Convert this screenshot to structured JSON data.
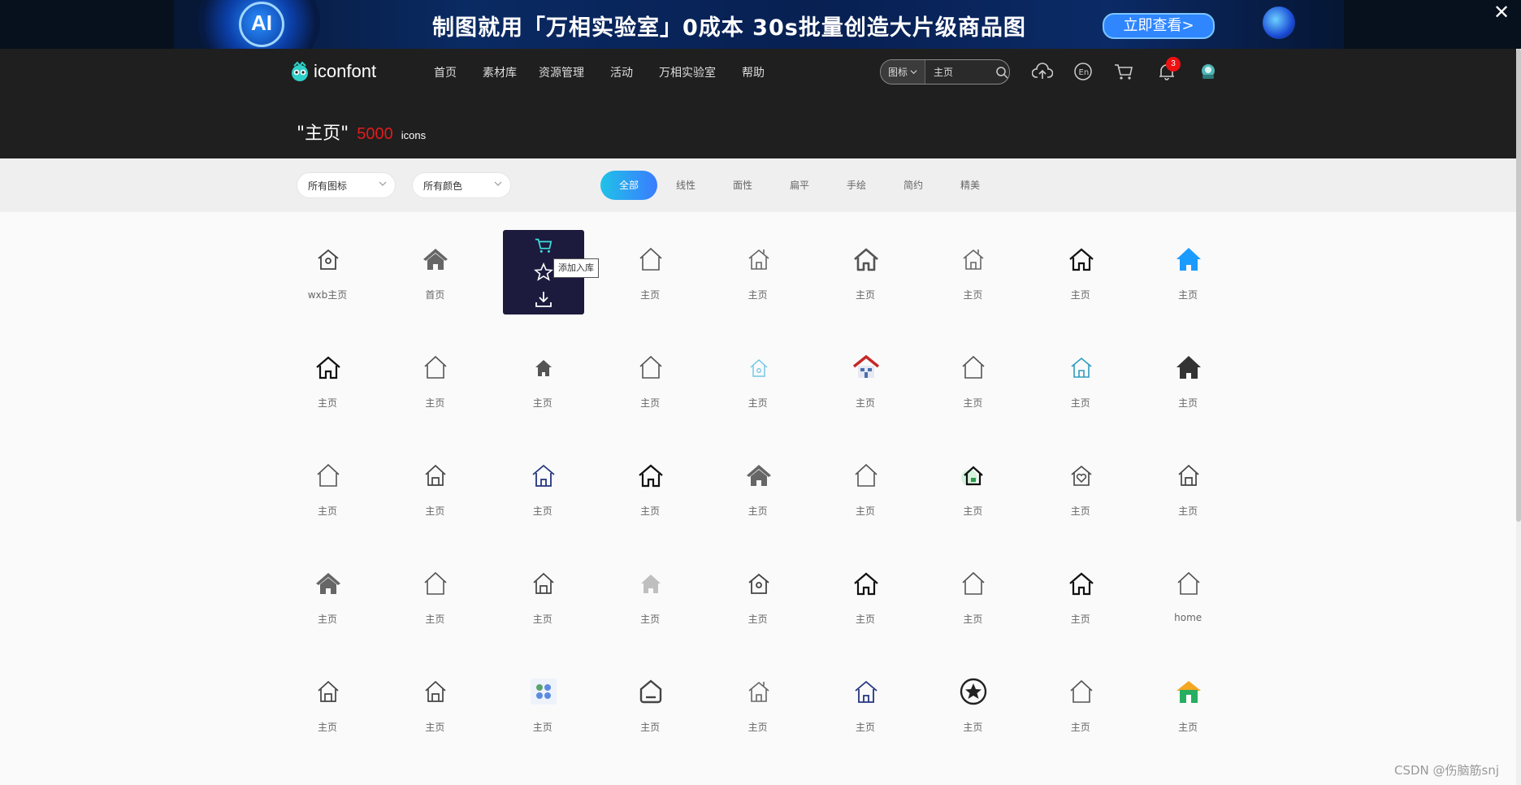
{
  "banner": {
    "orb_text": "AI",
    "headline": "制图就用「万相实验室」0成本 30s批量创造大片级商品图",
    "cta": "立即查看>"
  },
  "header": {
    "logo_text": "iconfont",
    "nav": [
      "首页",
      "素材库",
      "资源管理",
      "活动",
      "万相实验室",
      "帮助"
    ],
    "search": {
      "type": "图标",
      "value": "主页"
    },
    "notification_count": "3"
  },
  "title": {
    "query": "\"主页\"",
    "count": "5000",
    "unit": "icons"
  },
  "filters": {
    "icon_type": "所有图标",
    "color": "所有颜色",
    "tabs": [
      "全部",
      "线性",
      "面性",
      "扁平",
      "手绘",
      "简约",
      "精美"
    ]
  },
  "hover_tooltip": "添加入库",
  "icons": [
    {
      "label": "wxb主页",
      "icon": "home-outline-dot"
    },
    {
      "label": "首页",
      "icon": "home-filled-gray"
    },
    {
      "label": "",
      "icon": "hover-actions"
    },
    {
      "label": "主页",
      "icon": "home-outline-thin"
    },
    {
      "label": "主页",
      "icon": "home-outline-chimney"
    },
    {
      "label": "主页",
      "icon": "home-outline-bold"
    },
    {
      "label": "主页",
      "icon": "home-outline-chimney"
    },
    {
      "label": "主页",
      "icon": "home-outline-black"
    },
    {
      "label": "主页",
      "icon": "home-filled-blue"
    },
    {
      "label": "主页",
      "icon": "home-outline-black"
    },
    {
      "label": "主页",
      "icon": "home-outline-thin"
    },
    {
      "label": "主页",
      "icon": "home-filled-small"
    },
    {
      "label": "主页",
      "icon": "home-outline-thin"
    },
    {
      "label": "主页",
      "icon": "home-outline-cyan"
    },
    {
      "label": "主页",
      "icon": "home-red-roof"
    },
    {
      "label": "主页",
      "icon": "home-outline-thin"
    },
    {
      "label": "主页",
      "icon": "home-outline-teal"
    },
    {
      "label": "主页",
      "icon": "home-filled-black"
    },
    {
      "label": "主页",
      "icon": "home-outline-thin"
    },
    {
      "label": "主页",
      "icon": "home-outline-door"
    },
    {
      "label": "主页",
      "icon": "home-outline-navy"
    },
    {
      "label": "主页",
      "icon": "home-outline-black"
    },
    {
      "label": "主页",
      "icon": "home-filled-gray"
    },
    {
      "label": "主页",
      "icon": "home-outline-thin"
    },
    {
      "label": "主页",
      "icon": "home-green-circle"
    },
    {
      "label": "主页",
      "icon": "home-heart"
    },
    {
      "label": "主页",
      "icon": "home-outline-door"
    },
    {
      "label": "主页",
      "icon": "home-filled-gray"
    },
    {
      "label": "主页",
      "icon": "home-outline-thin"
    },
    {
      "label": "主页",
      "icon": "home-outline-door"
    },
    {
      "label": "主页",
      "icon": "home-filled-light"
    },
    {
      "label": "主页",
      "icon": "home-outline-dot"
    },
    {
      "label": "主页",
      "icon": "home-outline-black"
    },
    {
      "label": "主页",
      "icon": "home-outline-thin"
    },
    {
      "label": "主页",
      "icon": "home-outline-black"
    },
    {
      "label": "home",
      "icon": "home-outline-thin"
    },
    {
      "label": "主页",
      "icon": "home-outline-door"
    },
    {
      "label": "主页",
      "icon": "home-outline-door"
    },
    {
      "label": "主页",
      "icon": "home-app-dots"
    },
    {
      "label": "主页",
      "icon": "home-rounded-square"
    },
    {
      "label": "主页",
      "icon": "home-outline-chimney"
    },
    {
      "label": "主页",
      "icon": "home-outline-navy"
    },
    {
      "label": "主页",
      "icon": "home-star-circle"
    },
    {
      "label": "主页",
      "icon": "home-outline-thin"
    },
    {
      "label": "主页",
      "icon": "home-green-orange"
    }
  ],
  "watermark": "CSDN @伤脑筋snj"
}
